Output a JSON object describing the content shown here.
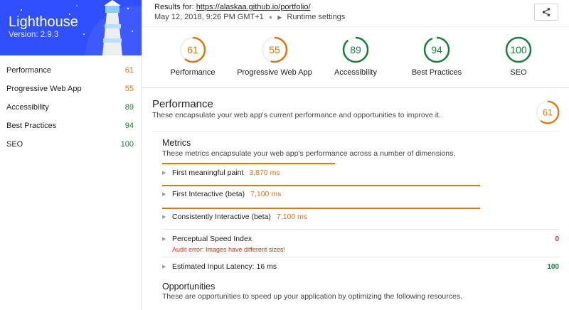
{
  "brand": {
    "title": "Lighthouse",
    "version": "Version: 2.9.3"
  },
  "sidebar": {
    "items": [
      {
        "label": "Performance",
        "score": "61"
      },
      {
        "label": "Progressive Web App",
        "score": "55"
      },
      {
        "label": "Accessibility",
        "score": "89"
      },
      {
        "label": "Best Practices",
        "score": "94"
      },
      {
        "label": "SEO",
        "score": "100"
      }
    ]
  },
  "header": {
    "results_prefix": "Results for: ",
    "url": "https://alaskaa.github.io/portfolio/",
    "date": "May 12, 2018, 9:26 PM GMT+1",
    "runtime_label": "Runtime settings"
  },
  "gauges": [
    {
      "label": "Performance",
      "score": "61",
      "value": 61,
      "color": "#e8710a"
    },
    {
      "label": "Progressive Web App",
      "score": "55",
      "value": 55,
      "color": "#e8710a"
    },
    {
      "label": "Accessibility",
      "score": "89",
      "value": 89,
      "color": "#188038"
    },
    {
      "label": "Best Practices",
      "score": "94",
      "value": 94,
      "color": "#188038"
    },
    {
      "label": "SEO",
      "score": "100",
      "value": 100,
      "color": "#188038"
    }
  ],
  "performance": {
    "title": "Performance",
    "description": "These encapsulate your web app's current performance and opportunities to improve it.",
    "score": "61",
    "value": 61
  },
  "metrics": {
    "title": "Metrics",
    "description": "These metrics encapsulate your web app's performance across a number of dimensions.",
    "items": [
      {
        "label": "First meaningful paint",
        "value": "3,870 ms"
      },
      {
        "label": "First Interactive (beta)",
        "value": "7,100 ms"
      },
      {
        "label": "Consistently Interactive (beta)",
        "value": "7,100 ms"
      },
      {
        "label": "Perceptual Speed Index",
        "score": "0",
        "error": "Audit error: Images have different sizes!"
      },
      {
        "label": "Estimated Input Latency: 16 ms",
        "score": "100"
      }
    ]
  },
  "opportunities": {
    "title": "Opportunities",
    "description": "These are opportunities to speed up your application by optimizing the following resources."
  },
  "colors": {
    "brand": "#304ffe",
    "fail_orange": "#e8710a",
    "pass_green": "#188038",
    "error_red": "#d93025"
  }
}
